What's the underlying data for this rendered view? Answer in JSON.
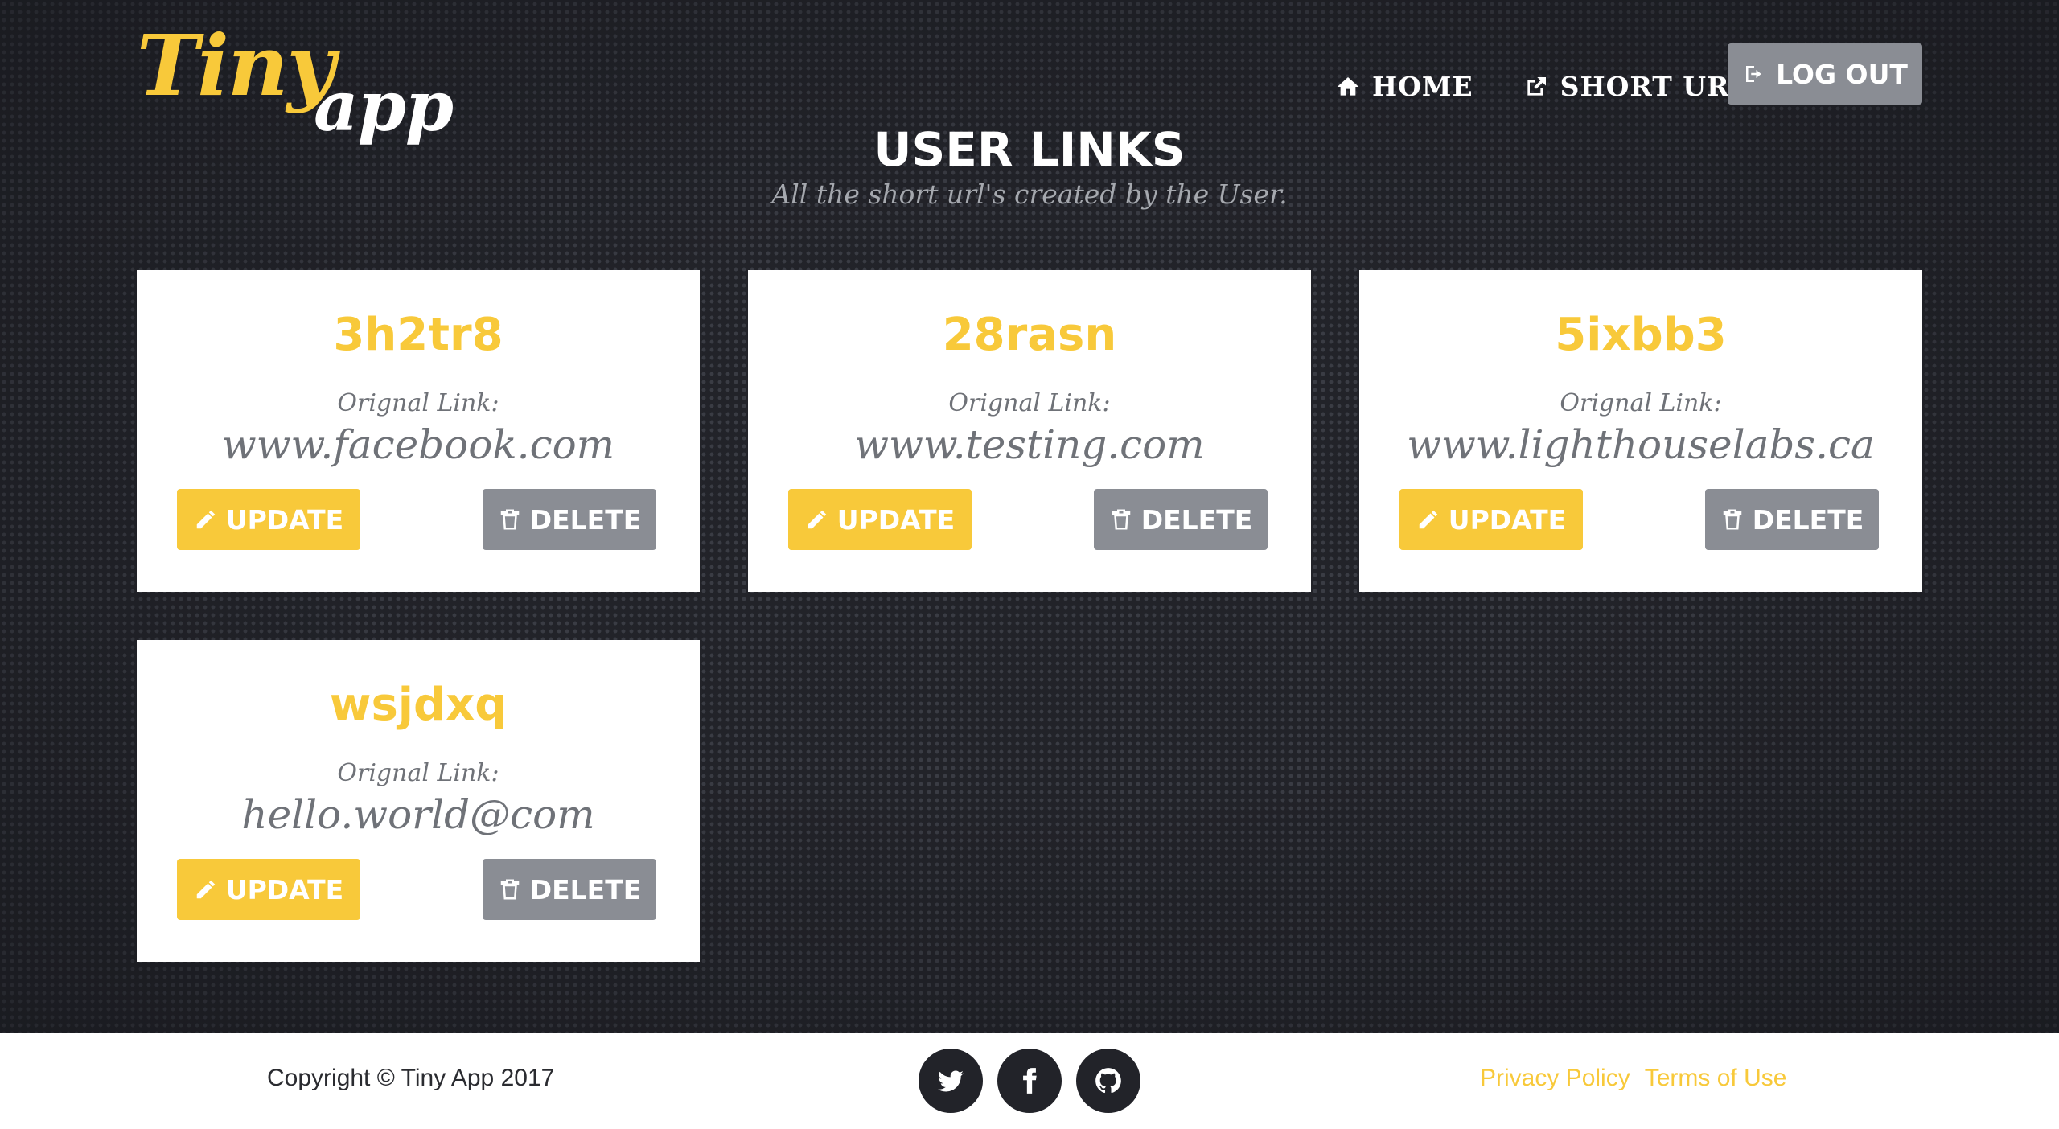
{
  "logo": {
    "word1": "Tiny",
    "word2": "app"
  },
  "nav": {
    "home_label": "HOME",
    "short_url_label": "SHORT URL",
    "logout_label": "LOG OUT"
  },
  "header": {
    "title": "USER LINKS",
    "subtitle": "All the short url's created by the User."
  },
  "cards": [
    {
      "code": "3h2tr8",
      "label": "Orignal Link:",
      "url": "www.facebook.com",
      "update_label": "UPDATE",
      "delete_label": "DELETE"
    },
    {
      "code": "28rasn",
      "label": "Orignal Link:",
      "url": "www.testing.com",
      "update_label": "UPDATE",
      "delete_label": "DELETE"
    },
    {
      "code": "5ixbb3",
      "label": "Orignal Link:",
      "url": "www.lighthouselabs.ca",
      "update_label": "UPDATE",
      "delete_label": "DELETE"
    },
    {
      "code": "wsjdxq",
      "label": "Orignal Link:",
      "url": "hello.world@com",
      "update_label": "UPDATE",
      "delete_label": "DELETE"
    }
  ],
  "footer": {
    "copyright": "Copyright © Tiny App 2017",
    "privacy_label": "Privacy Policy",
    "terms_label": "Terms of Use",
    "social_icons": [
      "twitter-icon",
      "facebook-icon",
      "github-icon"
    ]
  },
  "colors": {
    "accent": "#f8c93a",
    "background": "#222329",
    "button_gray": "#8a8d94",
    "text_gray": "#6f7278"
  }
}
